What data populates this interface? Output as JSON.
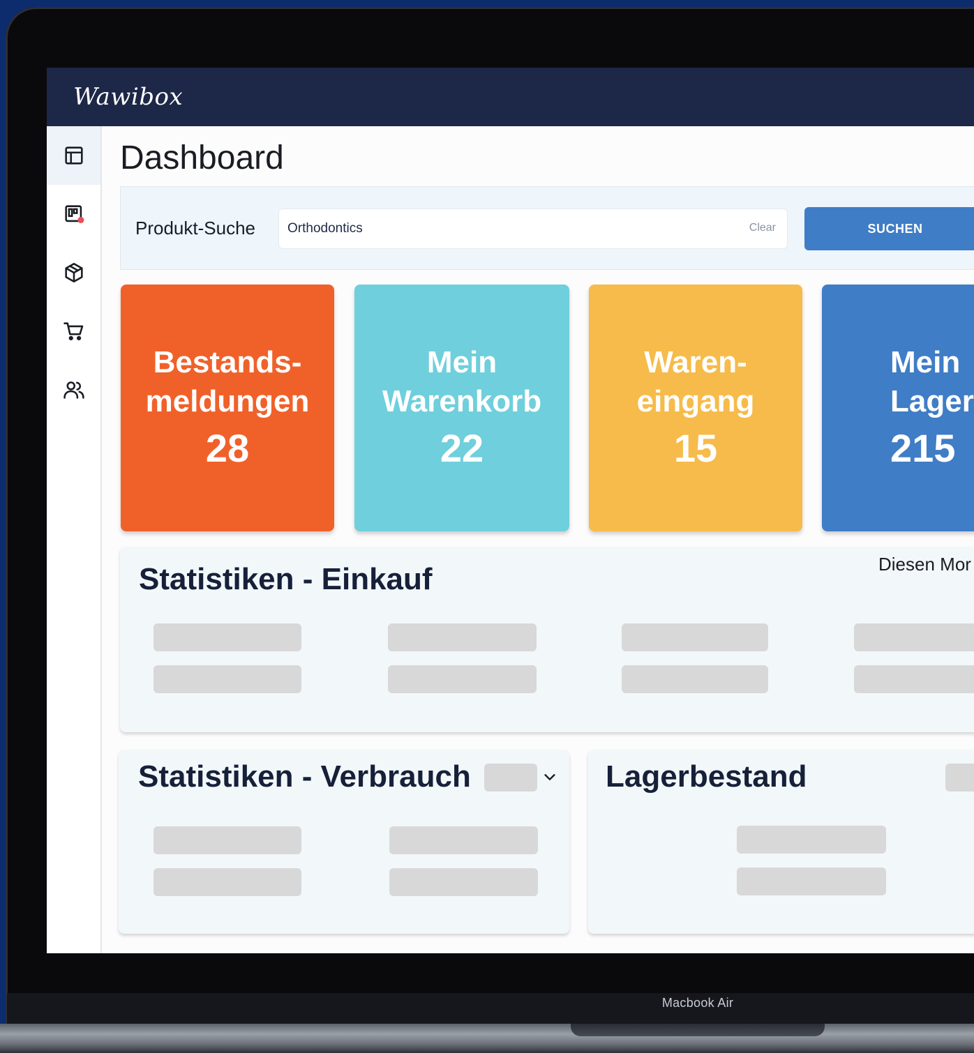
{
  "app": {
    "logo": "Wawibox"
  },
  "sidebar": {
    "items": [
      {
        "name": "dashboard",
        "icon": "layout-icon",
        "active": true
      },
      {
        "name": "notifications",
        "icon": "kanban-board-icon",
        "badge_color": "#e8505b"
      },
      {
        "name": "products",
        "icon": "package-icon"
      },
      {
        "name": "cart",
        "icon": "shopping-cart-icon"
      },
      {
        "name": "users",
        "icon": "users-icon"
      }
    ]
  },
  "page": {
    "title": "Dashboard"
  },
  "search": {
    "label": "Produkt-Suche",
    "value": "Orthodontics",
    "clear_label": "Clear",
    "button_label": "SUCHEN"
  },
  "tiles": [
    {
      "title_line1": "Bestands-",
      "title_line2": "meldungen",
      "count": "28",
      "color": "#f0612a"
    },
    {
      "title_line1": "Mein",
      "title_line2": "Warenkorb",
      "count": "22",
      "color": "#6fcfdc"
    },
    {
      "title_line1": "Waren-",
      "title_line2": "eingang",
      "count": "15",
      "color": "#f6bb4a"
    },
    {
      "title_line1": "Mein",
      "title_line2": "Lager",
      "count": "215",
      "color": "#3f7dc6"
    }
  ],
  "stats_einkauf": {
    "title": "Statistiken - Einkauf",
    "period": "Diesen Mor"
  },
  "stats_verbrauch": {
    "title": "Statistiken - Verbrauch"
  },
  "lagerbestand": {
    "title": "Lagerbestand"
  },
  "device": {
    "model": "Macbook Air"
  },
  "colors": {
    "topbar": "#1d2747",
    "accent": "#3f7dc6"
  }
}
